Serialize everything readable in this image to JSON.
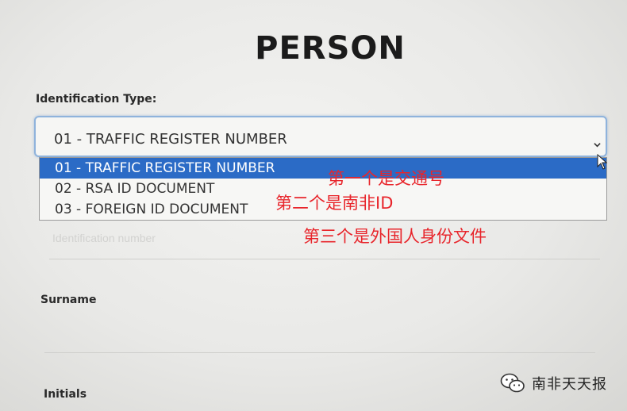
{
  "page": {
    "title": "PERSON"
  },
  "identification": {
    "label": "Identification Type:",
    "selected_value": "01 - TRAFFIC REGISTER NUMBER",
    "options": [
      {
        "label": "01 - TRAFFIC REGISTER NUMBER",
        "selected": true
      },
      {
        "label": "02 - RSA ID DOCUMENT",
        "selected": false
      },
      {
        "label": "03 - FOREIGN ID DOCUMENT",
        "selected": false
      }
    ],
    "number_placeholder": "Identification number"
  },
  "surname": {
    "label": "Surname"
  },
  "initials": {
    "label": "Initials"
  },
  "annotations": {
    "first": "第一个是交通号",
    "second": "第二个是南非ID",
    "third": "第三个是外国人身份文件"
  },
  "watermark": {
    "text": "南非天天报",
    "icon": "wechat-icon"
  },
  "colors": {
    "selection": "#2b6bc6",
    "annotation": "#e8252b",
    "focus_border": "#8fb3dc"
  }
}
